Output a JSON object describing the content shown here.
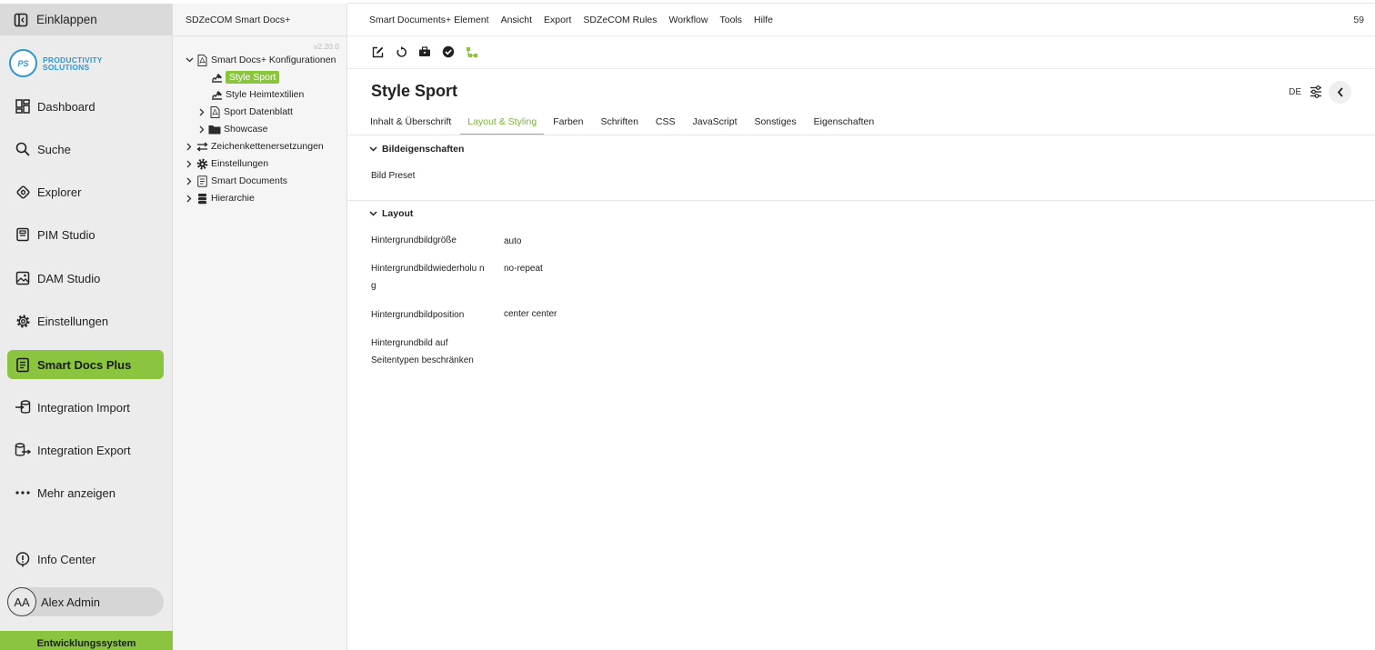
{
  "sidebar": {
    "collapse_label": "Einklappen",
    "logo": {
      "mark": "PS",
      "line1": "PRODUCTIVITY",
      "line2": "SOLUTIONS"
    },
    "items": [
      {
        "label": "Dashboard",
        "icon": "dashboard-icon"
      },
      {
        "label": "Suche",
        "icon": "search-icon"
      },
      {
        "label": "Explorer",
        "icon": "explorer-icon"
      },
      {
        "label": "PIM Studio",
        "icon": "pim-studio-icon"
      },
      {
        "label": "DAM Studio",
        "icon": "image-icon"
      },
      {
        "label": "Einstellungen",
        "icon": "gear-icon"
      },
      {
        "label": "Smart Docs Plus",
        "icon": "document-icon",
        "active": true
      },
      {
        "label": "Integration Import",
        "icon": "database-import-icon"
      },
      {
        "label": "Integration Export",
        "icon": "database-export-icon"
      },
      {
        "label": "Mehr anzeigen",
        "icon": "more-icon"
      }
    ],
    "info_center": "Info Center",
    "user": {
      "initials": "AA",
      "name": "Alex Admin"
    },
    "environment": "Entwicklungssystem"
  },
  "tree": {
    "title": "SDZeCOM Smart Docs+",
    "version": "v2.20.0",
    "nodes": [
      {
        "label": "Smart Docs+ Konfigurationen",
        "expanded": true
      },
      {
        "label": "Style Sport",
        "selected": true
      },
      {
        "label": "Style Heimtextilien"
      },
      {
        "label": "Sport Datenblatt"
      },
      {
        "label": "Showcase"
      },
      {
        "label": "Zeichenkettenersetzungen"
      },
      {
        "label": "Einstellungen"
      },
      {
        "label": "Smart Documents"
      },
      {
        "label": "Hierarchie"
      }
    ]
  },
  "menubar": {
    "items": [
      "Smart Documents+ Element",
      "Ansicht",
      "Export",
      "SDZeCOM Rules",
      "Workflow",
      "Tools",
      "Hilfe"
    ],
    "counter": "59"
  },
  "page": {
    "title": "Style Sport",
    "language": "DE",
    "tabs": [
      "Inhalt & Überschrift",
      "Layout & Styling",
      "Farben",
      "Schriften",
      "CSS",
      "JavaScript",
      "Sonstiges",
      "Eigenschaften"
    ],
    "active_tab": "Layout & Styling"
  },
  "sections": {
    "image_props": {
      "title": "Bildeigenschaften",
      "fields": [
        {
          "label": "Bild Preset",
          "value": ""
        }
      ]
    },
    "layout": {
      "title": "Layout",
      "fields": [
        {
          "label": "Hintergrundbildgröße",
          "value": "auto"
        },
        {
          "label": "Hintergrundbildwiederholu ng",
          "value": "no-repeat"
        },
        {
          "label": "Hintergrundbildposition",
          "value": "center center"
        },
        {
          "label": "Hintergrundbild auf Seitentypen beschränken",
          "value": ""
        }
      ]
    }
  },
  "colors": {
    "accent": "#8bc53f",
    "accent_text": "#7ab534",
    "logo_blue": "#2f98d4"
  }
}
